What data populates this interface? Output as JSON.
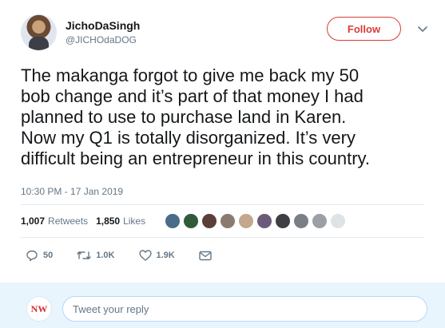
{
  "user": {
    "display_name": "JichoDaSingh",
    "handle": "@JICHOdaDOG"
  },
  "follow_button": {
    "label": "Follow",
    "color": "#d83d38"
  },
  "tweet": {
    "lines": [
      "The makanga forgot to give me back my 50",
      "bob change and it’s part of that money I had",
      "planned to use to purchase land in Karen.",
      "Now my Q1 is totally disorganized. It’s very",
      "difficult being an entrepreneur in this country."
    ],
    "timestamp": "10:30 PM - 17 Jan 2019"
  },
  "stats": {
    "retweets_count": "1,007",
    "retweets_label": "Retweets",
    "likes_count": "1,850",
    "likes_label": "Likes"
  },
  "likers": [
    {
      "icon": "avatar",
      "color": "#4a6b8a"
    },
    {
      "icon": "avatar",
      "color": "#2f5b3a"
    },
    {
      "icon": "avatar",
      "color": "#5a4038"
    },
    {
      "icon": "avatar",
      "color": "#8a7b70"
    },
    {
      "icon": "avatar",
      "color": "#c4a88d"
    },
    {
      "icon": "avatar",
      "color": "#6b5a7a"
    },
    {
      "icon": "avatar",
      "color": "#3e3e44"
    },
    {
      "icon": "avatar",
      "color": "#7a7f86"
    },
    {
      "icon": "avatar",
      "color": "#9aa0a6"
    },
    {
      "icon": "avatar",
      "color": "#dfe3e6"
    }
  ],
  "actions": {
    "replies": "50",
    "retweets": "1.0K",
    "likes": "1.9K"
  },
  "reply": {
    "avatar_text": "NW",
    "placeholder": "Tweet your reply"
  }
}
